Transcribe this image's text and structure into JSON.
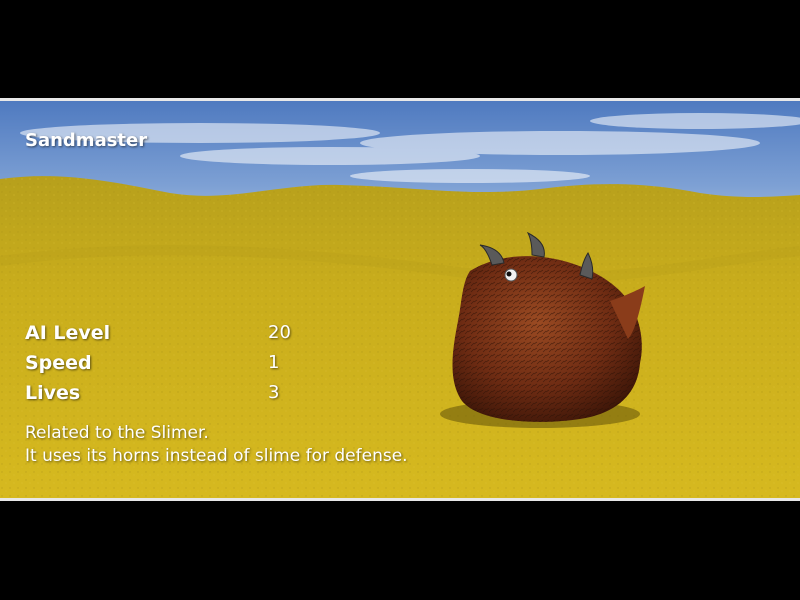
{
  "creature": {
    "name": "Sandmaster",
    "stats": [
      {
        "label": "AI Level",
        "value": "20"
      },
      {
        "label": "Speed",
        "value": "1"
      },
      {
        "label": "Lives",
        "value": "3"
      }
    ],
    "description": [
      "Related to the Slimer.",
      "It uses its horns instead of slime for defense."
    ]
  },
  "colors": {
    "sky": "#5b83c4",
    "sand": "#c9ad1c",
    "creature_body": "#7a3418",
    "frame_line": "#e8e8e8",
    "text": "#ffffff"
  }
}
